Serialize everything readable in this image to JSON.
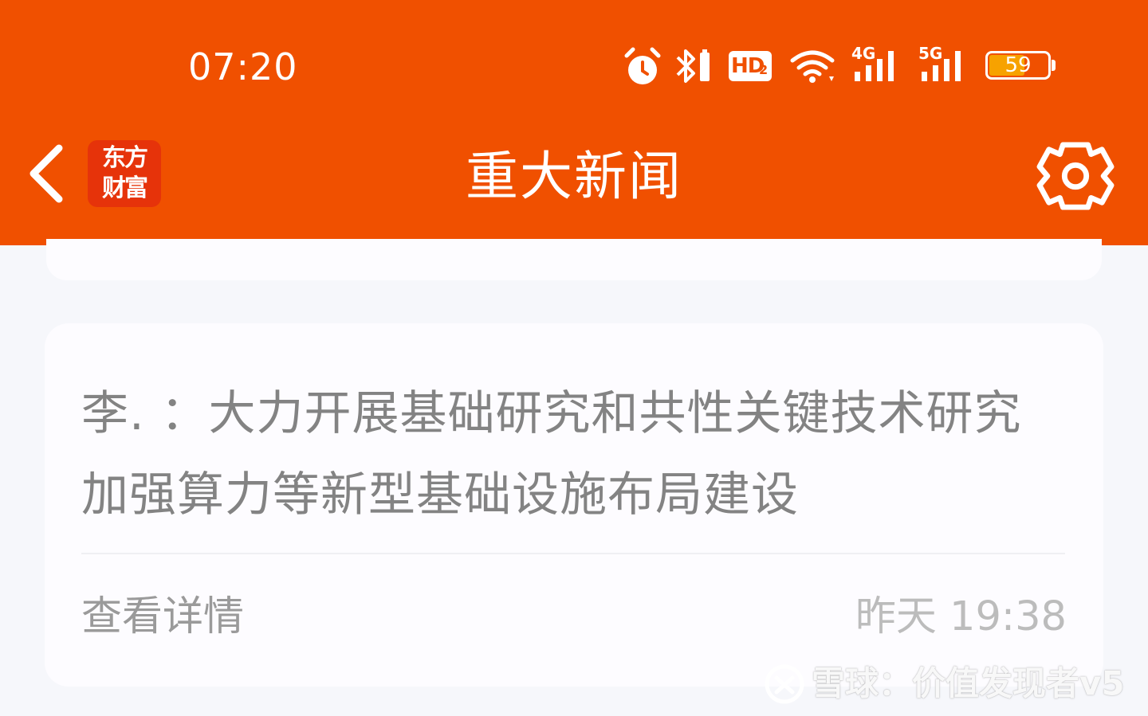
{
  "status_bar": {
    "time": "07:20",
    "network_4g": "4G",
    "network_5g": "5G",
    "hd_label": "HD",
    "battery": "59",
    "icons": [
      "alarm-icon",
      "bluetooth-icon",
      "hd-volte-icon",
      "wifi-icon",
      "signal-4g-icon",
      "signal-5g-icon",
      "battery-icon"
    ]
  },
  "nav": {
    "back_icon": "chevron-left-icon",
    "app_logo_line1": "东方",
    "app_logo_line2": "财富",
    "title": "重大新闻",
    "settings_icon": "gear-icon"
  },
  "card": {
    "headline": "李.  ：大力开展基础研究和共性关键技术研究加强算力等新型基础设施布局建设",
    "detail_link": "查看详情",
    "timestamp": "昨天 19:38"
  },
  "watermark": {
    "text": "雪球：价值发现者v5"
  },
  "colors": {
    "brand_orange": "#f05000",
    "page_background": "#f6f7fb",
    "card_background": "#fdfcff",
    "headline_text": "#838383"
  }
}
